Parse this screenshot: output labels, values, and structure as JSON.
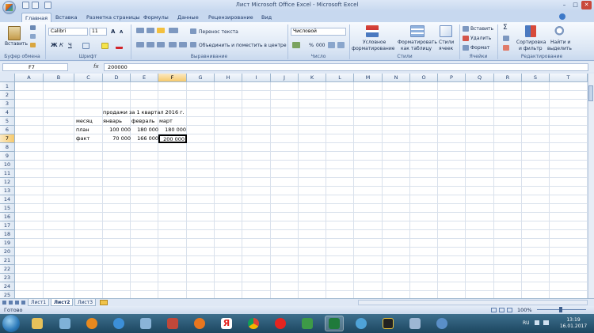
{
  "window": {
    "title": "Лист Microsoft Office Excel - Microsoft Excel",
    "minimize": "–",
    "maximize": "□",
    "close": "✕"
  },
  "tabs": [
    "Главная",
    "Вставка",
    "Разметка страницы",
    "Формулы",
    "Данные",
    "Рецензирование",
    "Вид"
  ],
  "active_tab": "Главная",
  "ribbon": {
    "clipboard": {
      "paste": "Вставить",
      "label": "Буфер обмена"
    },
    "font": {
      "name": "Calibri",
      "size": "11",
      "bold": "Ж",
      "italic": "К",
      "underline": "Ч",
      "grow": "A",
      "shrink": "A",
      "label": "Шрифт"
    },
    "alignment": {
      "wrap": "Перенос текста",
      "merge": "Объединить и поместить в центре",
      "label": "Выравнивание"
    },
    "number": {
      "format": "Числовой",
      "percent": "%",
      "thousands": "000",
      "label": "Число"
    },
    "styles": {
      "conditional1": "Условное",
      "conditional2": "форматирование",
      "table1": "Форматировать",
      "table2": "как таблицу",
      "cell1": "Стили",
      "cell2": "ячеек",
      "label": "Стили"
    },
    "cells": {
      "insert": "Вставить",
      "delete": "Удалить",
      "format": "Формат",
      "label": "Ячейки"
    },
    "editing": {
      "sum": "Σ",
      "sort1": "Сортировка",
      "sort2": "и фильтр",
      "find1": "Найти и",
      "find2": "выделить",
      "label": "Редактирование"
    }
  },
  "formula_bar": {
    "cell_ref": "F7",
    "fx": "fx",
    "value": "200000"
  },
  "columns": [
    "A",
    "B",
    "C",
    "D",
    "E",
    "F",
    "G",
    "H",
    "I",
    "J",
    "K",
    "L",
    "M",
    "N",
    "O",
    "P",
    "Q",
    "R",
    "S",
    "T"
  ],
  "selected_column": "F",
  "rows": [
    "1",
    "2",
    "3",
    "4",
    "5",
    "6",
    "7",
    "8",
    "9",
    "10",
    "11",
    "12",
    "13",
    "14",
    "15",
    "16",
    "17",
    "18",
    "19",
    "20",
    "21",
    "22",
    "23",
    "24",
    "25"
  ],
  "selected_row": "7",
  "cells": {
    "title": "продажи за 1 квартал 2016 г.",
    "month": "месяц",
    "jan": "январь",
    "feb": "февраль",
    "mar": "март",
    "plan": "план",
    "plan_jan": "100 000",
    "plan_feb": "180 000",
    "plan_mar": "180 000",
    "fact": "факт",
    "fact_jan": "70 000",
    "fact_feb": "166 000",
    "fact_mar": "200 000"
  },
  "sheets": [
    "Лист1",
    "Лист2",
    "Лист3"
  ],
  "active_sheet": "Лист2",
  "status": {
    "ready": "Готово",
    "zoom": "100%"
  },
  "taskbar": {
    "time": "13:19",
    "date": "16.01.2017",
    "lang": "RU"
  },
  "colors": {
    "accent": "#1e3a6a",
    "selection": "#f6c96b",
    "taskbar": "#1c4660"
  }
}
